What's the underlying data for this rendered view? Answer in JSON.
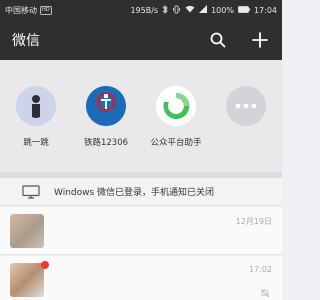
{
  "status_bar": {
    "carrier": "中国移动",
    "hd": "HD",
    "speed": "195B/s",
    "battery": "100%",
    "time": "17:04"
  },
  "app_bar": {
    "title": "微信"
  },
  "mini_programs": [
    {
      "label": "跳一跳",
      "icon": "jump-jump-icon",
      "color": "#c9d1e8"
    },
    {
      "label": "铁路12306",
      "icon": "railway-icon",
      "color": "#1a6bb8"
    },
    {
      "label": "公众平台助手",
      "icon": "mp-assistant-icon",
      "color": "#3fbf57"
    },
    {
      "label": "",
      "icon": "more-icon",
      "color": "#d4d4d8"
    }
  ],
  "railway_logo_text": "中国铁路",
  "pc_login": {
    "text": "Windows 微信已登录，手机通知已关闭"
  },
  "chats": [
    {
      "name": "",
      "preview": "",
      "time": "12月19日"
    },
    {
      "name": "",
      "preview": "",
      "time": "17:02"
    }
  ],
  "colors": {
    "bar_bg": "#2f2f30",
    "accent_green": "#3fbf57",
    "railway_blue": "#1a6bb8",
    "badge_red": "#f43530"
  }
}
